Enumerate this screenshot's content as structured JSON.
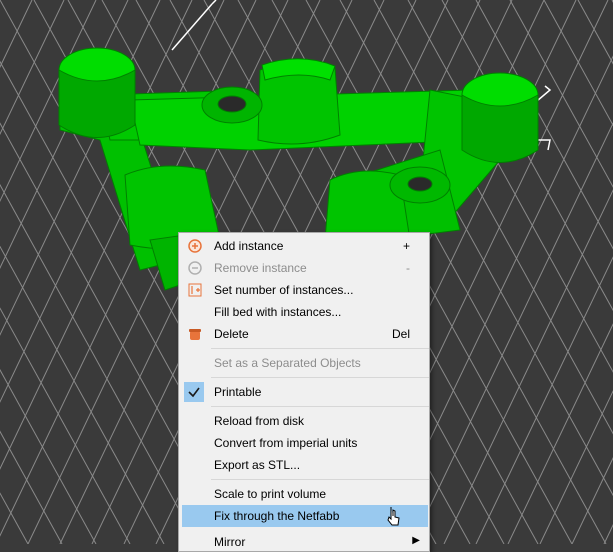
{
  "colors": {
    "background": "#3a3a3a",
    "grid": "#888888",
    "model": "#00d200",
    "model_shadow": "#009900",
    "menu_bg": "#f0f0f0",
    "highlight": "#99c9ef",
    "disabled_text": "#8d8d8d"
  },
  "menu": {
    "items": [
      {
        "label": "Add instance",
        "shortcut": "+",
        "icon": "add-icon",
        "enabled": true
      },
      {
        "label": "Remove instance",
        "shortcut": "-",
        "icon": "remove-icon",
        "enabled": false
      },
      {
        "label": "Set number of instances...",
        "shortcut": "",
        "icon": "instances-icon",
        "enabled": true
      },
      {
        "label": "Fill bed with instances...",
        "shortcut": "",
        "icon": "",
        "enabled": true
      },
      {
        "label": "Delete",
        "shortcut": "Del",
        "icon": "delete-icon",
        "enabled": true
      },
      {
        "label": "Set as a Separated Objects",
        "shortcut": "",
        "icon": "",
        "enabled": false
      },
      {
        "label": "Printable",
        "shortcut": "",
        "icon": "checkmark-icon",
        "enabled": true,
        "checked": true
      },
      {
        "label": "Reload from disk",
        "shortcut": "",
        "icon": "",
        "enabled": true
      },
      {
        "label": "Convert from imperial units",
        "shortcut": "",
        "icon": "",
        "enabled": true
      },
      {
        "label": "Export as STL...",
        "shortcut": "",
        "icon": "",
        "enabled": true
      },
      {
        "label": "Scale to print volume",
        "shortcut": "",
        "icon": "",
        "enabled": true
      },
      {
        "label": "Fix through the Netfabb",
        "shortcut": "",
        "icon": "",
        "enabled": true,
        "highlighted": true
      },
      {
        "label": "Mirror",
        "shortcut": "",
        "icon": "submenu-arrow-icon",
        "enabled": true
      }
    ]
  }
}
